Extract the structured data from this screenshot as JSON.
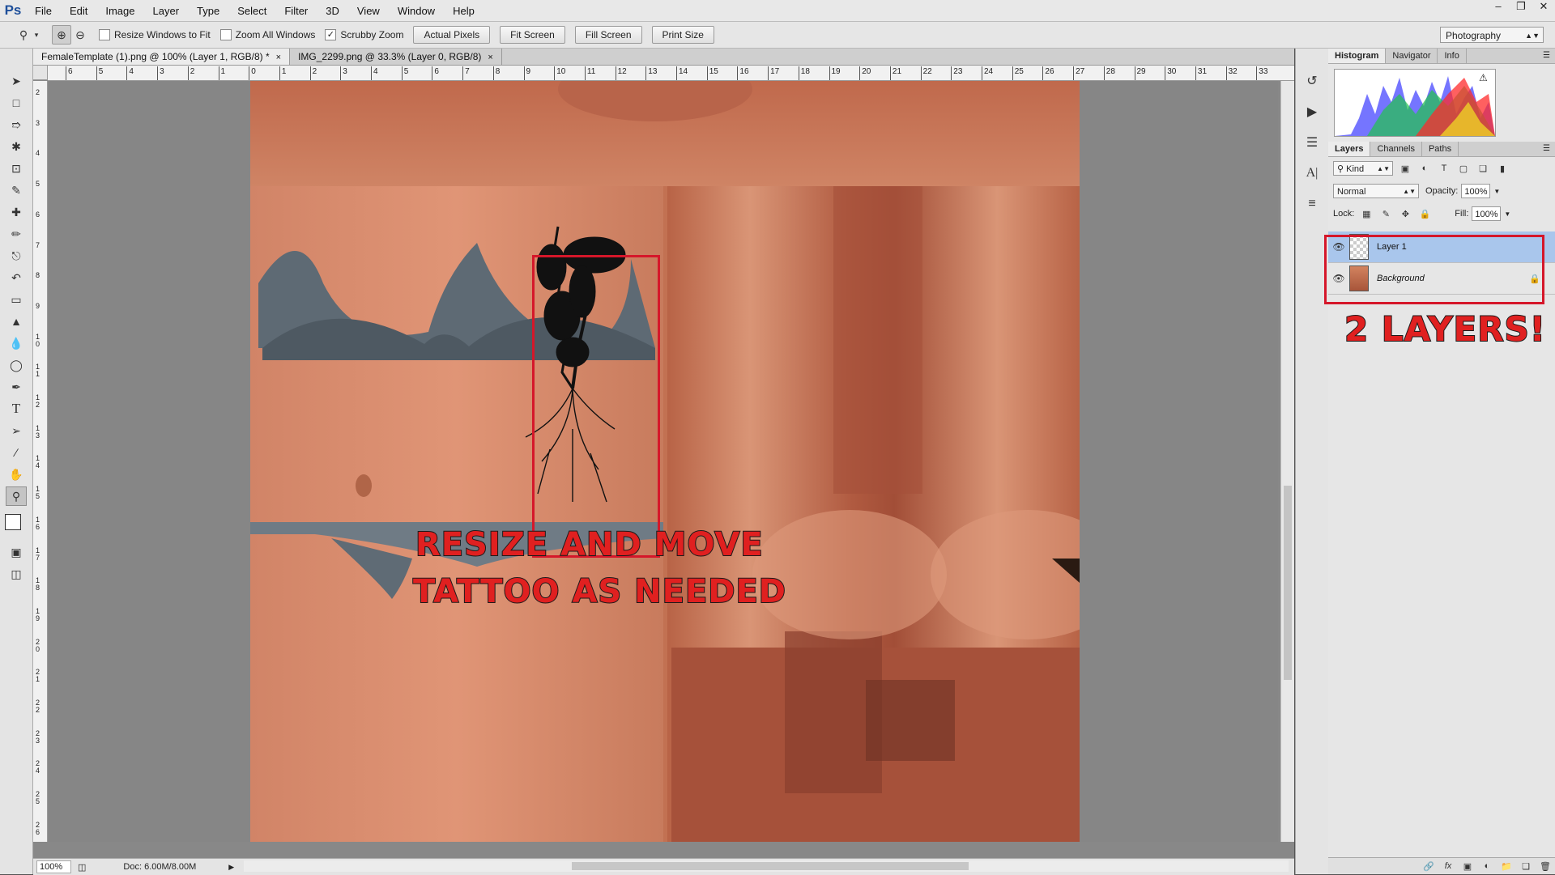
{
  "app": {
    "logo": "Ps"
  },
  "menu": [
    "File",
    "Edit",
    "Image",
    "Layer",
    "Type",
    "Select",
    "Filter",
    "3D",
    "View",
    "Window",
    "Help"
  ],
  "options": {
    "resize_windows": "Resize Windows to Fit",
    "zoom_all": "Zoom All Windows",
    "scrubby": "Scrubby Zoom",
    "buttons": [
      "Actual Pixels",
      "Fit Screen",
      "Fill Screen",
      "Print Size"
    ],
    "workspace": "Photography",
    "scrubby_checked": true
  },
  "tabs": [
    {
      "label": "FemaleTemplate (1).png @ 100% (Layer 1, RGB/8) *",
      "active": true
    },
    {
      "label": "IMG_2299.png @ 33.3% (Layer 0, RGB/8)",
      "active": false
    }
  ],
  "ruler_top": [
    "6",
    "5",
    "4",
    "3",
    "2",
    "1",
    "0",
    "1",
    "2",
    "3",
    "4",
    "5",
    "6",
    "7",
    "8",
    "9",
    "10",
    "11",
    "12",
    "13",
    "14",
    "15",
    "16",
    "17",
    "18",
    "19",
    "20",
    "21",
    "22",
    "23",
    "24",
    "25",
    "26",
    "27",
    "28",
    "29",
    "30",
    "31",
    "32",
    "33"
  ],
  "ruler_left": [
    "2",
    "3",
    "4",
    "5",
    "6",
    "7",
    "8",
    "9",
    "10",
    "11",
    "12",
    "13",
    "14",
    "15",
    "16",
    "17",
    "18",
    "19",
    "20",
    "21",
    "22",
    "23",
    "24",
    "25",
    "26"
  ],
  "status": {
    "zoom": "100%",
    "doc": "Doc: 6.00M/8.00M"
  },
  "annotations": {
    "line1": "Resize and move",
    "line2": "tattoo as needed",
    "layers": "2 Layers!"
  },
  "panels": {
    "top_tabs": [
      "Histogram",
      "Navigator",
      "Info"
    ],
    "layer_tabs": [
      "Layers",
      "Channels",
      "Paths"
    ],
    "kind": "Kind",
    "blend_mode": "Normal",
    "opacity_label": "Opacity:",
    "opacity": "100%",
    "lock_label": "Lock:",
    "fill_label": "Fill:",
    "fill": "100%",
    "layers": [
      {
        "name": "Layer 1",
        "selected": true
      },
      {
        "name": "Background",
        "selected": false
      }
    ]
  },
  "icons": {
    "zoom_tool": "zoom-icon",
    "eye": "visibility-eye-icon",
    "lock": "lock-icon"
  }
}
